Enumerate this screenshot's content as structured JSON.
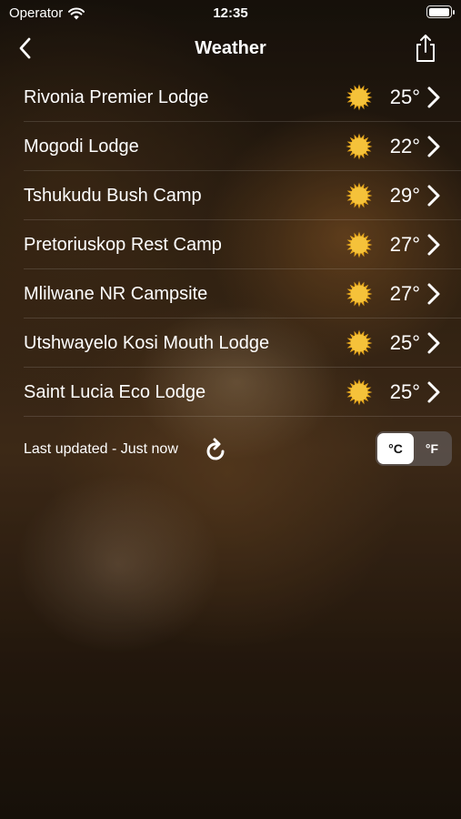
{
  "status_bar": {
    "carrier": "Operator",
    "time": "12:35"
  },
  "nav": {
    "title": "Weather"
  },
  "locations": [
    {
      "name": "Rivonia Premier Lodge",
      "temp": "25°",
      "condition_icon": "sun-icon"
    },
    {
      "name": "Mogodi Lodge",
      "temp": "22°",
      "condition_icon": "sun-icon"
    },
    {
      "name": "Tshukudu Bush Camp",
      "temp": "29°",
      "condition_icon": "sun-icon"
    },
    {
      "name": "Pretoriuskop Rest Camp",
      "temp": "27°",
      "condition_icon": "sun-icon"
    },
    {
      "name": "Mlilwane NR Campsite",
      "temp": "27°",
      "condition_icon": "sun-icon"
    },
    {
      "name": "Utshwayelo Kosi Mouth Lodge",
      "temp": "25°",
      "condition_icon": "sun-icon"
    },
    {
      "name": "Saint Lucia Eco Lodge",
      "temp": "25°",
      "condition_icon": "sun-icon"
    }
  ],
  "footer": {
    "last_updated": "Last updated - Just now",
    "unit_celsius": "°C",
    "unit_fahrenheit": "°F",
    "selected_unit": "°C"
  },
  "colors": {
    "sun_core": "#f5c23a",
    "sun_rays": "#e8a91e",
    "text": "#ffffff"
  }
}
